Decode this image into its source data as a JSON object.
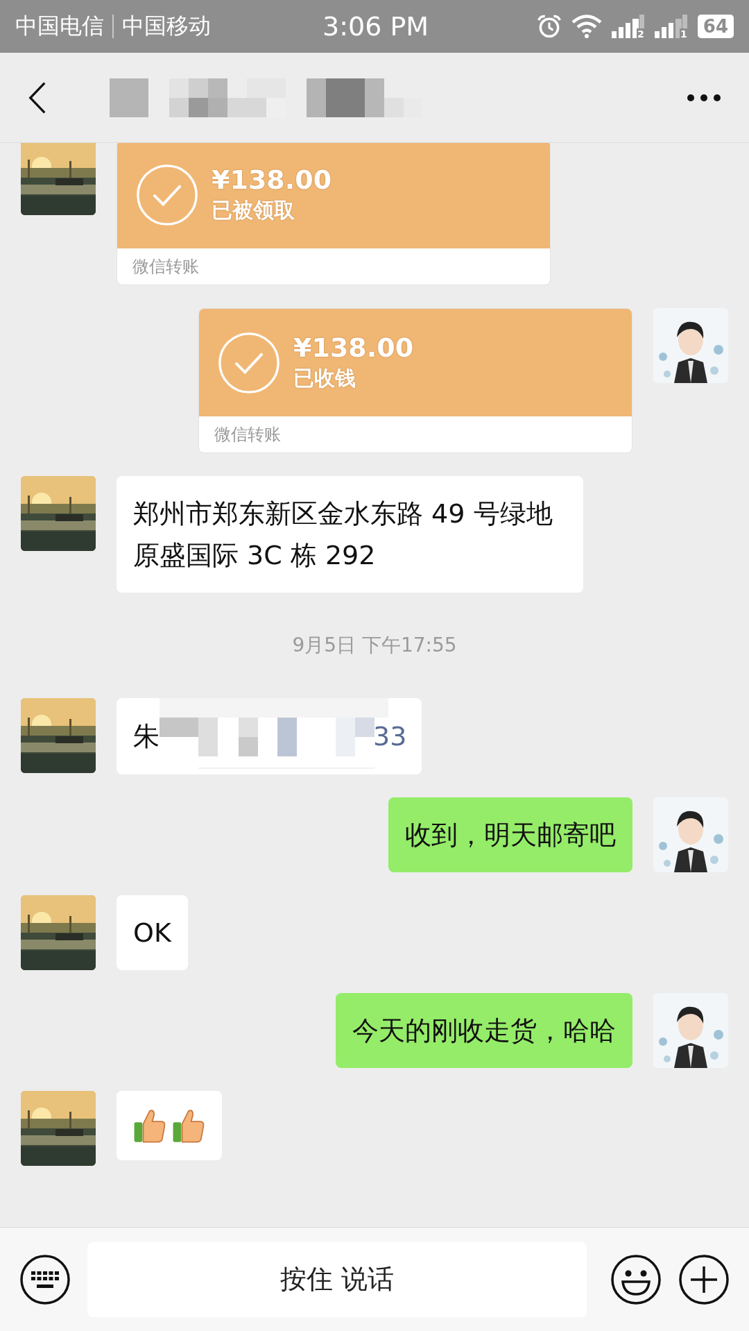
{
  "status_bar": {
    "carriers": [
      "中国电信",
      "中国移动"
    ],
    "time": "3:06 PM",
    "signals": [
      {
        "label": "2"
      },
      {
        "label": "1"
      }
    ],
    "battery": "64"
  },
  "messages": [
    {
      "kind": "transfer",
      "outgoing": false,
      "amount": "¥138.00",
      "status": "已被领取",
      "footer": "微信转账"
    },
    {
      "kind": "transfer",
      "outgoing": true,
      "amount": "¥138.00",
      "status": "已收钱",
      "footer": "微信转账"
    },
    {
      "kind": "text",
      "outgoing": false,
      "text": "郑州市郑东新区金水东路 49 号绿地原盛国际 3C 栋 292"
    },
    {
      "kind": "time",
      "text": "9月5日 下午17:55"
    },
    {
      "kind": "redacted",
      "outgoing": false,
      "text_start": "朱",
      "text_end": "33"
    },
    {
      "kind": "text",
      "outgoing": true,
      "text": "收到，明天邮寄吧"
    },
    {
      "kind": "text",
      "outgoing": false,
      "text": "OK"
    },
    {
      "kind": "text",
      "outgoing": true,
      "text": "今天的刚收走货，哈哈"
    },
    {
      "kind": "emoji",
      "outgoing": false,
      "emojis": [
        {
          "kind": "thumbs_up"
        },
        {
          "kind": "thumbs_up"
        }
      ]
    }
  ],
  "input_bar": {
    "voice_button": "按住 说话"
  }
}
